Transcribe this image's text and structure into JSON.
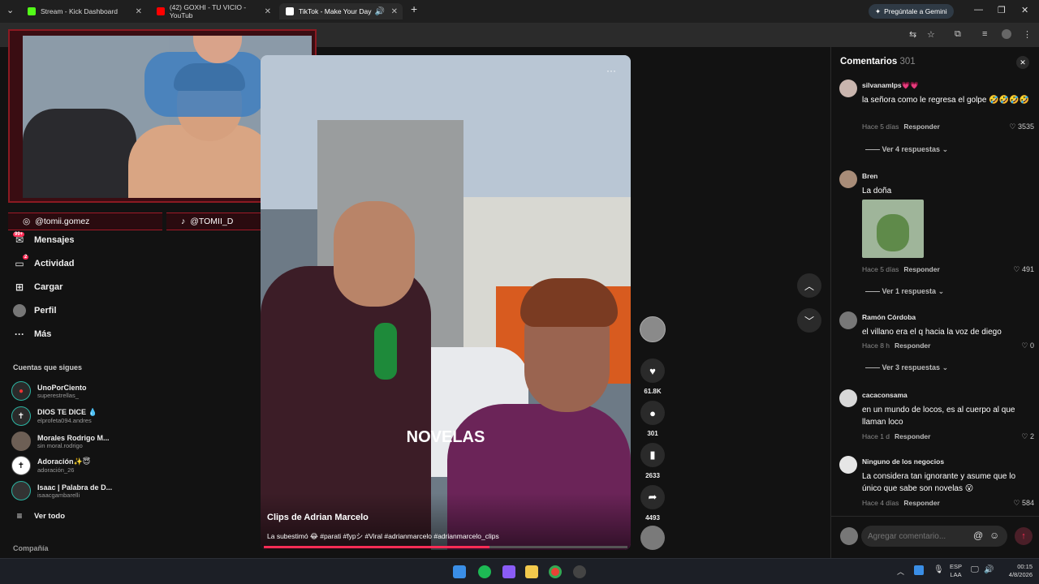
{
  "browser": {
    "tabs": [
      {
        "title": "Stream - Kick Dashboard",
        "color": "#53fc18"
      },
      {
        "title": "(42) GOXHI - TU VICIO - YouTub",
        "color": "#ff0000"
      },
      {
        "title": "TikTok - Make Your Day",
        "color": "#ffffff"
      }
    ],
    "gemini_label": "Pregúntale a Gemini"
  },
  "stream_overlay": {
    "handle_left": "@tomii.gomez",
    "handle_right": "@TOMII_D"
  },
  "sidebar": {
    "nav": [
      {
        "label": "Mensajes",
        "icon": "message-icon",
        "badge": "99+"
      },
      {
        "label": "Actividad",
        "icon": "activity-icon",
        "badge": "2"
      },
      {
        "label": "Cargar",
        "icon": "upload-icon",
        "badge": ""
      },
      {
        "label": "Perfil",
        "icon": "profile-icon",
        "badge": ""
      },
      {
        "label": "Más",
        "icon": "more-icon",
        "badge": ""
      }
    ],
    "following_title": "Cuentas que sigues",
    "following": [
      {
        "name": "UnoPorCiento",
        "handle": "superestrellas_"
      },
      {
        "name": "DIOS TE DICE 💧",
        "handle": "elprofeta094.andres"
      },
      {
        "name": "Morales Rodrigo M...",
        "handle": "sin moral.rodrigo"
      },
      {
        "name": "Adoración✨😇",
        "handle": "adoración_26"
      },
      {
        "name": "Isaac | Palabra de D...",
        "handle": "isaacgambarelli"
      }
    ],
    "see_all": "Ver todo",
    "company": "Compañía"
  },
  "video": {
    "overlay_text": "NOVELAS",
    "author": "Clips de Adrian Marcelo",
    "caption": "La subestimó 😂 #parati #fypシ #Viral #adrianmarcelo #adrianmarcelo_clips",
    "progress": 0.62,
    "more_label": "···"
  },
  "actions": {
    "likes": "61.8K",
    "comments": "301",
    "saves": "2633",
    "shares": "4493"
  },
  "comments_panel": {
    "title": "Comentarios",
    "count": "301",
    "input_placeholder": "Agregar comentario...",
    "reply_label": "Responder",
    "items": [
      {
        "user": "silvanamlps💗💗",
        "text": "la señora como le regresa el golpe 🤣🤣🤣🤣",
        "time": "Hace 5 días",
        "likes": "3535",
        "replies": "Ver 4 respuestas"
      },
      {
        "user": "Bren",
        "text": "La doña",
        "time": "Hace 5 días",
        "likes": "491",
        "replies": "Ver 1 respuesta"
      },
      {
        "user": "Ramón Córdoba",
        "text": "el villano era el q hacia la voz de diego",
        "time": "Hace 8 h",
        "likes": "0",
        "replies": "Ver 3 respuestas"
      },
      {
        "user": "cacaconsama",
        "text": "en un mundo de locos, es al cuerpo al que llaman loco",
        "time": "Hace 1 d",
        "likes": "2",
        "replies": ""
      },
      {
        "user": "Ninguno de los negocios",
        "text": "La considera tan ignorante y asume que lo único que sabe son novelas 😮",
        "time": "Hace 4 días",
        "likes": "584",
        "replies": ""
      }
    ]
  },
  "taskbar": {
    "lang": "ESP",
    "region": "LAA",
    "time": "00:15",
    "date": "4/8/2026"
  }
}
